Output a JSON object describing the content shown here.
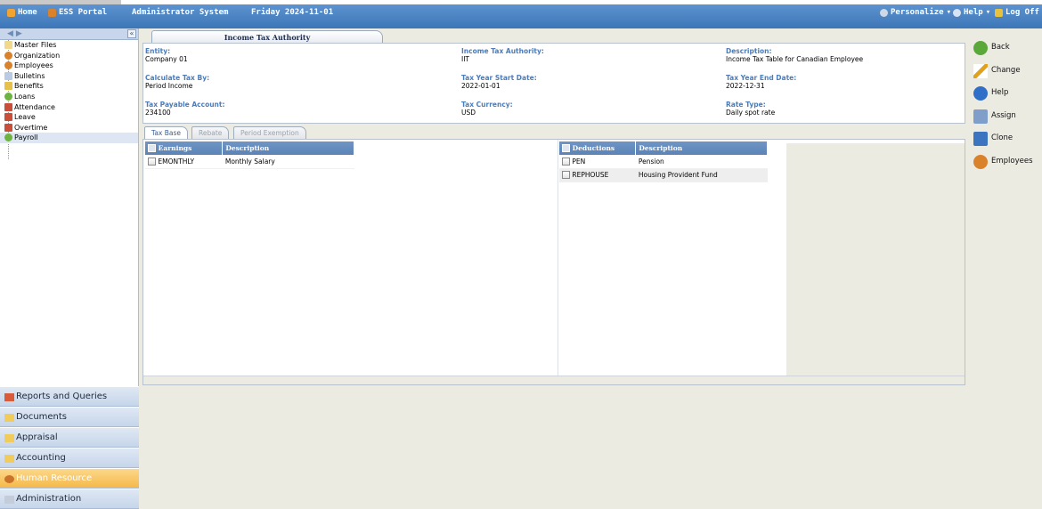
{
  "topbar": {
    "home": "Home",
    "ess_portal": "ESS Portal",
    "system_name": "Administrator System",
    "date": "Friday 2024-11-01",
    "personalize": "Personalize",
    "help": "Help",
    "log_off": "Log Off"
  },
  "sidebar": {
    "tree": [
      "Master Files",
      "Organization",
      "Employees",
      "Bulletins",
      "Benefits",
      "Loans",
      "Attendance",
      "Leave",
      "Overtime",
      "Payroll"
    ],
    "modules": [
      "Reports and Queries",
      "Documents",
      "Appraisal",
      "Accounting",
      "Human Resource",
      "Administration"
    ]
  },
  "main": {
    "title_tab": "Income Tax Authority",
    "fields": {
      "entity_label": "Entity:",
      "entity_value": "Company 01",
      "ita_label": "Income Tax Authority:",
      "ita_value": "IIT",
      "desc_label": "Description:",
      "desc_value": "Income Tax Table for Canadian Employee",
      "calc_label": "Calculate Tax By:",
      "calc_value": "Period Income",
      "start_label": "Tax Year Start Date:",
      "start_value": "2022-01-01",
      "end_label": "Tax Year End Date:",
      "end_value": "2022-12-31",
      "account_label": "Tax Payable Account:",
      "account_value": "234100",
      "currency_label": "Tax Currency:",
      "currency_value": "USD",
      "rate_label": "Rate Type:",
      "rate_value": "Daily spot rate"
    },
    "subtabs": [
      "Tax Base",
      "Rebate",
      "Period Exemption"
    ],
    "earnings": {
      "headers": [
        "Earnings",
        "Description"
      ],
      "rows": [
        [
          "EMONTHLY",
          "Monthly Salary"
        ]
      ]
    },
    "deductions": {
      "headers": [
        "Deductions",
        "Description"
      ],
      "rows": [
        [
          "PEN",
          "Pension"
        ],
        [
          "REPHOUSE",
          "Housing Provident Fund"
        ]
      ]
    }
  },
  "actions": [
    "Back",
    "Change",
    "Help",
    "Assign",
    "Clone",
    "Employees"
  ]
}
